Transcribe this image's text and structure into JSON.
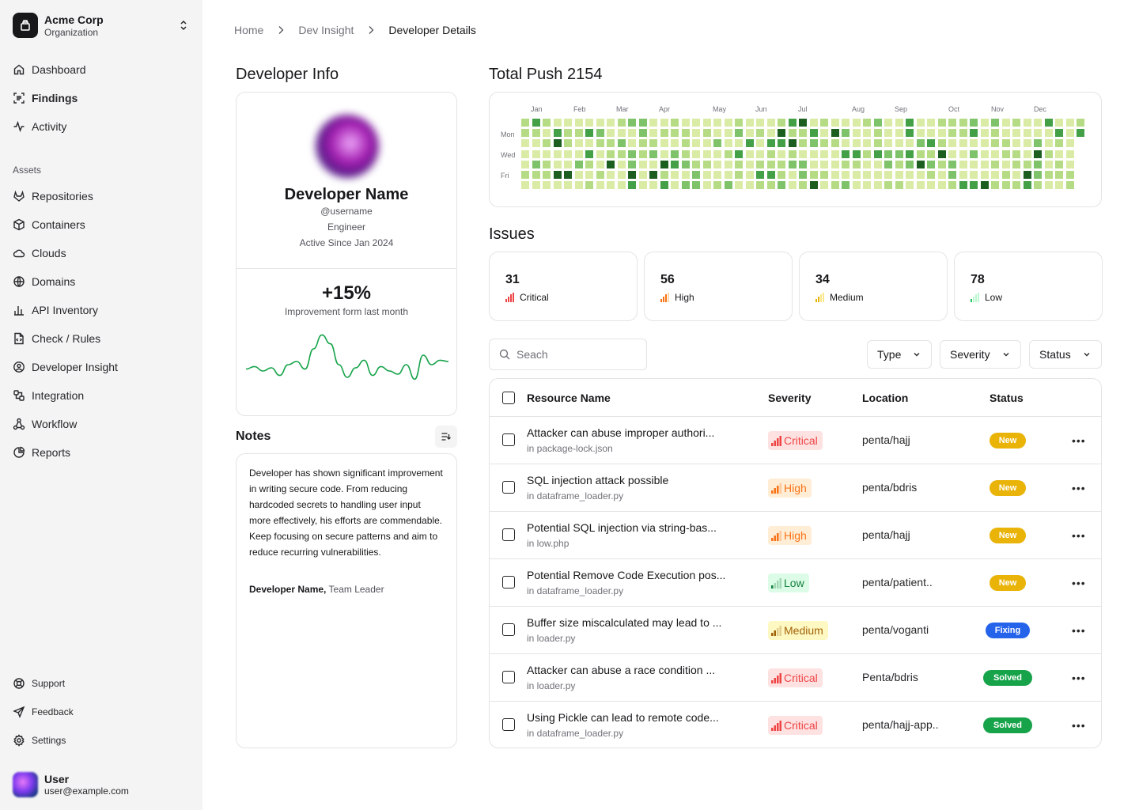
{
  "org": {
    "name": "Acme Corp",
    "subtitle": "Organization"
  },
  "nav": {
    "main": [
      {
        "label": "Dashboard",
        "icon": "home-icon"
      },
      {
        "label": "Findings",
        "icon": "scan-icon"
      },
      {
        "label": "Activity",
        "icon": "activity-icon"
      }
    ],
    "assets_label": "Assets",
    "assets": [
      {
        "label": "Repositories",
        "icon": "gitlab-icon"
      },
      {
        "label": "Containers",
        "icon": "box-icon"
      },
      {
        "label": "Clouds",
        "icon": "cloud-icon"
      },
      {
        "label": "Domains",
        "icon": "globe-icon"
      },
      {
        "label": "API Inventory",
        "icon": "bar-chart-icon"
      },
      {
        "label": "Check / Rules",
        "icon": "file-code-icon"
      },
      {
        "label": "Developer Insight",
        "icon": "user-circle-icon"
      },
      {
        "label": "Integration",
        "icon": "integration-icon"
      },
      {
        "label": "Workflow",
        "icon": "workflow-icon"
      },
      {
        "label": "Reports",
        "icon": "pie-chart-icon"
      }
    ],
    "footer": [
      {
        "label": "Support",
        "icon": "lifebuoy-icon"
      },
      {
        "label": "Feedback",
        "icon": "send-icon"
      },
      {
        "label": "Settings",
        "icon": "gear-icon"
      }
    ]
  },
  "user": {
    "name": "User",
    "email": "user@example.com"
  },
  "breadcrumb": [
    "Home",
    "Dev Insight",
    "Developer Details"
  ],
  "developer_info": {
    "title": "Developer Info",
    "name": "Developer Name",
    "username": "@username",
    "role": "Engineer",
    "active_since": "Active Since Jan 2024",
    "improvement": "+15%",
    "improvement_label": "Improvement form last month",
    "sparkline": [
      0.62,
      0.58,
      0.65,
      0.6,
      0.72,
      0.55,
      0.5,
      0.62,
      0.3,
      0.08,
      0.22,
      0.55,
      0.75,
      0.6,
      0.48,
      0.72,
      0.58,
      0.65,
      0.7,
      0.55,
      0.78,
      0.4,
      0.55,
      0.48,
      0.5
    ]
  },
  "notes": {
    "title": "Notes",
    "text": "Developer has shown significant improvement in writing secure code. From reducing hardcoded secrets to handling user input more effectively, his efforts are commendable. Keep focusing on secure patterns and aim to reduce recurring vulnerabilities.",
    "author": "Developer Name,",
    "author_role": "Team Leader"
  },
  "push": {
    "title": "Total Push 2154",
    "months": [
      "Jan",
      "Feb",
      "Mar",
      "Apr",
      "May",
      "Jun",
      "Jul",
      "Aug",
      "Sep",
      "Oct",
      "Nov",
      "Dec"
    ],
    "days": [
      "Mon",
      "Wed",
      "Fri"
    ],
    "colors": [
      "#d9eba5",
      "#b5dc84",
      "#7ec26a",
      "#43a047",
      "#1b5e20"
    ]
  },
  "issues": {
    "title": "Issues",
    "cards": [
      {
        "count": "31",
        "label": "Critical",
        "color": "#ef4444"
      },
      {
        "count": "56",
        "label": "High",
        "color": "#f97316"
      },
      {
        "count": "34",
        "label": "Medium",
        "color": "#eab308"
      },
      {
        "count": "78",
        "label": "Low",
        "color": "#22c55e"
      }
    ]
  },
  "filters": {
    "search_placeholder": "Seach",
    "type": "Type",
    "severity": "Severity",
    "status": "Status"
  },
  "table": {
    "headers": [
      "Resource Name",
      "Severity",
      "Location",
      "Status"
    ],
    "rows": [
      {
        "name": "Attacker can abuse improper authori...",
        "file": "in package-lock.json",
        "severity": "Critical",
        "location": "penta/hajj",
        "status": "New"
      },
      {
        "name": "SQL injection attack possible",
        "file": "in dataframe_loader.py",
        "severity": "High",
        "location": "penta/bdris",
        "status": "New"
      },
      {
        "name": "Potential SQL injection via string-bas...",
        "file": "in low.php",
        "severity": "High",
        "location": "penta/hajj",
        "status": "New"
      },
      {
        "name": "Potential Remove Code Execution pos...",
        "file": "in dataframe_loader.py",
        "severity": "Low",
        "location": "penta/patient..",
        "status": "New"
      },
      {
        "name": "Buffer size miscalculated may lead to ...",
        "file": "in loader.py",
        "severity": "Medium",
        "location": "penta/voganti",
        "status": "Fixing"
      },
      {
        "name": "Attacker can abuse a race condition ...",
        "file": "in loader.py",
        "severity": "Critical",
        "location": "Penta/bdris",
        "status": "Solved"
      },
      {
        "name": "Using Pickle can lead to remote code...",
        "file": "in dataframe_loader.py",
        "severity": "Critical",
        "location": "penta/hajj-app..",
        "status": "Solved"
      }
    ]
  },
  "severity_styles": {
    "Critical": {
      "bg": "#fee2e2",
      "fg": "#ef4444"
    },
    "High": {
      "bg": "#ffedd5",
      "fg": "#f97316"
    },
    "Medium": {
      "bg": "#fef9c3",
      "fg": "#a16207"
    },
    "Low": {
      "bg": "#dcfce7",
      "fg": "#15803d"
    }
  },
  "status_styles": {
    "New": "#eab308",
    "Fixing": "#2563eb",
    "Solved": "#16a34a"
  }
}
